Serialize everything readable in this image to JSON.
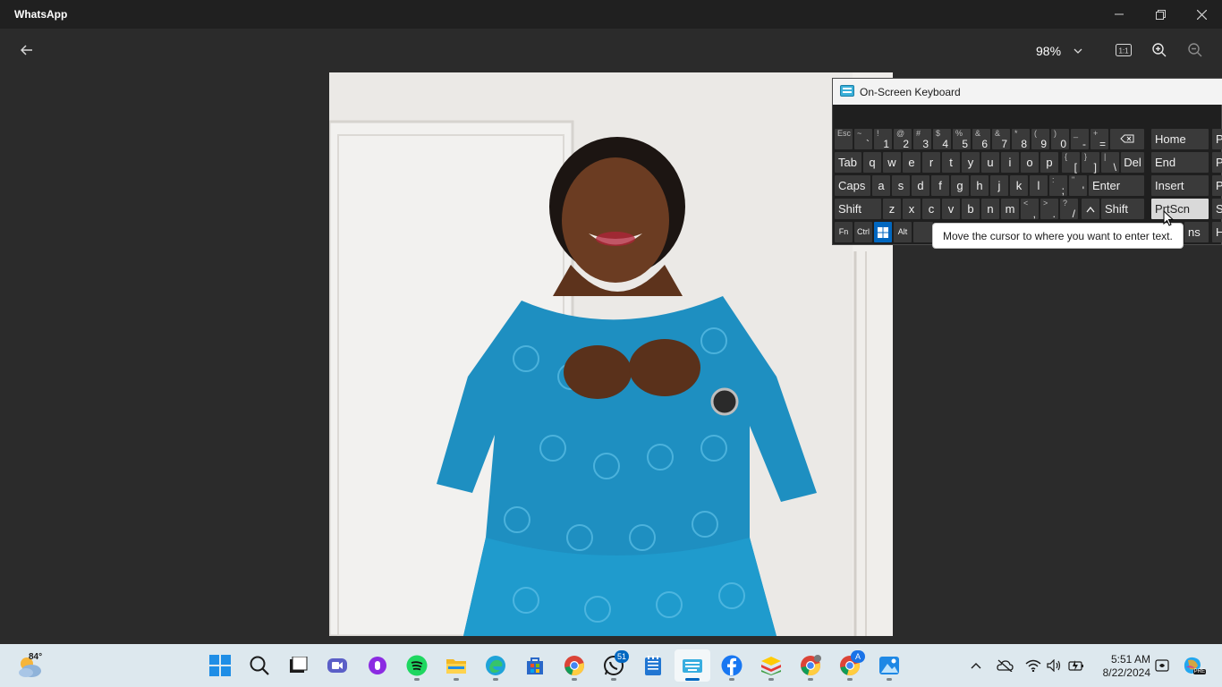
{
  "window": {
    "title": "WhatsApp"
  },
  "viewer": {
    "zoom_level": "98%"
  },
  "osk": {
    "title": "On-Screen Keyboard",
    "tooltip": "Move the cursor to where you want to enter text.",
    "row1": [
      {
        "sub": "Esc",
        "main": ""
      },
      {
        "sub": "~",
        "main": "`"
      },
      {
        "sub": "!",
        "main": "1"
      },
      {
        "sub": "@",
        "main": "2"
      },
      {
        "sub": "#",
        "main": "3"
      },
      {
        "sub": "$",
        "main": "4"
      },
      {
        "sub": "%",
        "main": "5"
      },
      {
        "sub": "&",
        "main": "6"
      },
      {
        "sub": "&",
        "main": "7"
      },
      {
        "sub": "*",
        "main": "8"
      },
      {
        "sub": "(",
        "main": "9"
      },
      {
        "sub": ")",
        "main": "0"
      },
      {
        "sub": "_",
        "main": "-"
      },
      {
        "sub": "+",
        "main": "="
      }
    ],
    "row2": [
      "Tab",
      "q",
      "w",
      "e",
      "r",
      "t",
      "y",
      "u",
      "i",
      "o",
      "p"
    ],
    "row2_extra": [
      {
        "sub": "{",
        "main": "["
      },
      {
        "sub": "}",
        "main": "]"
      },
      {
        "sub": "|",
        "main": "\\"
      }
    ],
    "row3": [
      "Caps",
      "a",
      "s",
      "d",
      "f",
      "g",
      "h",
      "j",
      "k",
      "l"
    ],
    "row3_extra": [
      {
        "sub": ":",
        "main": ";"
      },
      {
        "sub": "\"",
        "main": "'"
      }
    ],
    "row4": [
      "Shift",
      "z",
      "x",
      "c",
      "v",
      "b",
      "n",
      "m"
    ],
    "row4_extra": [
      {
        "sub": "<",
        "main": ","
      },
      {
        "sub": ">",
        "main": "."
      },
      {
        "sub": "?",
        "main": "/"
      }
    ],
    "del": "Del",
    "enter": "Enter",
    "shift_right": "Shift",
    "fn": "Fn",
    "ctrl": "Ctrl",
    "alt": "Alt",
    "nav": [
      "Home",
      "End",
      "Insert",
      "PrtScn"
    ],
    "nav_right": [
      "P",
      "P",
      "P",
      "S"
    ],
    "nav_bottom": "ns",
    "nav_bottom_right": "H"
  },
  "taskbar": {
    "weather_temp": "84°",
    "whatsapp_badge": "51",
    "chrome_profile_badge": "A",
    "time": "5:51 AM",
    "date": "8/22/2024",
    "copilot_badge": "PRE"
  }
}
